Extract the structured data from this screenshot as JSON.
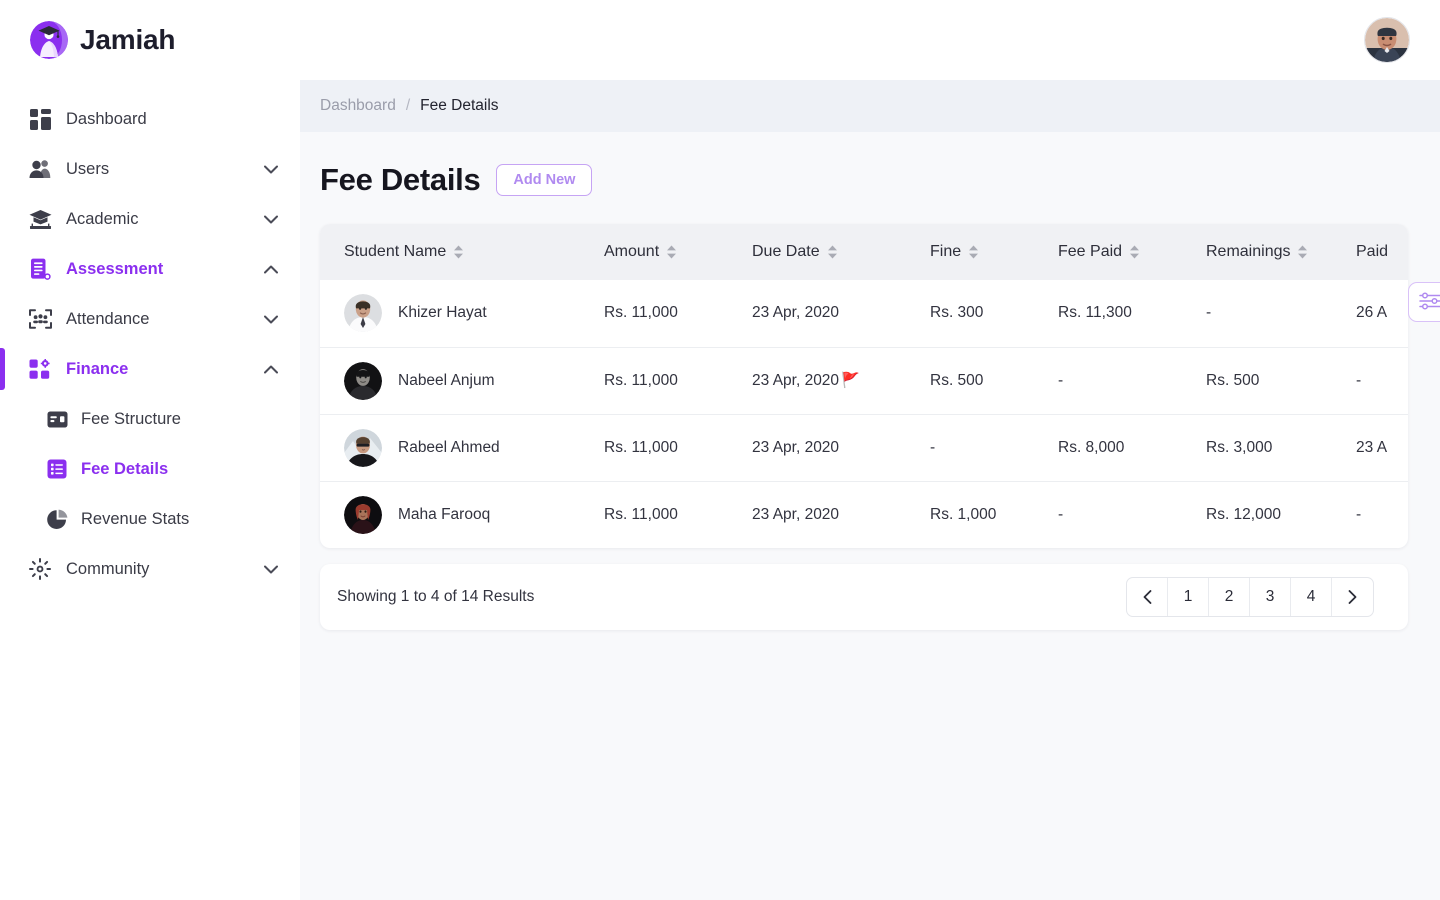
{
  "brand": {
    "name": "Jamiah",
    "logo_icon": "graduate-circle-logo",
    "logo_color": "#8b2fef"
  },
  "theme": {
    "accent": "#8b2fef",
    "accent_soft": "#b08af0",
    "page_bg": "#f8f9fb",
    "breadcrumb_bg": "#eef1f6",
    "table_header_bg": "#f0f1f4",
    "text_primary": "#23242f",
    "text_muted": "#9a9daa",
    "flag_color": "#b84a3a"
  },
  "topbar": {
    "avatar_icon": "user-avatar",
    "avatar_alt": "Account avatar"
  },
  "sidebar": {
    "items": [
      {
        "label": "Dashboard",
        "icon": "dashboard-grid-icon",
        "expandable": false,
        "active": false
      },
      {
        "label": "Users",
        "icon": "users-icon",
        "expandable": true,
        "expanded": false,
        "active": false
      },
      {
        "label": "Academic",
        "icon": "graduation-cap-icon",
        "expandable": true,
        "expanded": false,
        "active": false
      },
      {
        "label": "Assessment",
        "icon": "assessment-document-icon",
        "expandable": true,
        "expanded": true,
        "active": true
      },
      {
        "label": "Attendance",
        "icon": "attendance-people-icon",
        "expandable": true,
        "expanded": false,
        "active": false
      },
      {
        "label": "Finance",
        "icon": "finance-grid-gear-icon",
        "expandable": true,
        "expanded": true,
        "active": true
      },
      {
        "label": "Community",
        "icon": "community-network-icon",
        "expandable": true,
        "expanded": false,
        "active": false
      }
    ],
    "finance_children": [
      {
        "label": "Fee Structure",
        "icon": "fee-structure-card-icon",
        "active": false
      },
      {
        "label": "Fee Details",
        "icon": "fee-details-list-icon",
        "active": true
      },
      {
        "label": "Revenue Stats",
        "icon": "revenue-pie-icon",
        "active": false
      }
    ]
  },
  "breadcrumb": {
    "parent": "Dashboard",
    "separator": "/",
    "current": "Fee Details"
  },
  "page": {
    "title": "Fee Details",
    "add_new_label": "Add New",
    "filter_icon": "filter-sliders-icon"
  },
  "table": {
    "columns": [
      {
        "label": "Student Name",
        "sortable": true
      },
      {
        "label": "Amount",
        "sortable": true
      },
      {
        "label": "Due Date",
        "sortable": true
      },
      {
        "label": "Fine",
        "sortable": true
      },
      {
        "label": "Fee Paid",
        "sortable": true
      },
      {
        "label": "Remainings",
        "sortable": true
      },
      {
        "label": "Paid",
        "sortable": true
      }
    ],
    "rows": [
      {
        "student_name": "Khizer Hayat",
        "avatar_icon": "student-avatar",
        "amount": "Rs. 11,000",
        "due_date": "23 Apr, 2020",
        "due_flagged": false,
        "fine": "Rs. 300",
        "fee_paid": "Rs. 11,300",
        "remainings": "-",
        "paid_date": "26 A"
      },
      {
        "student_name": "Nabeel Anjum",
        "avatar_icon": "student-avatar",
        "amount": "Rs. 11,000",
        "due_date": "23 Apr, 2020",
        "due_flagged": true,
        "flag_glyph": "🚩",
        "fine": "Rs. 500",
        "fee_paid": "-",
        "remainings": "Rs. 500",
        "paid_date": "-"
      },
      {
        "student_name": "Rabeel Ahmed",
        "avatar_icon": "student-avatar",
        "amount": "Rs. 11,000",
        "due_date": "23 Apr, 2020",
        "due_flagged": false,
        "fine": "-",
        "fee_paid": "Rs. 8,000",
        "remainings": "Rs. 3,000",
        "paid_date": "23 A"
      },
      {
        "student_name": "Maha Farooq",
        "avatar_icon": "student-avatar",
        "amount": "Rs. 11,000",
        "due_date": "23 Apr, 2020",
        "due_flagged": false,
        "fine": "Rs. 1,000",
        "fee_paid": "-",
        "remainings": "Rs. 12,000",
        "paid_date": "-"
      }
    ]
  },
  "pagination": {
    "showing_text": "Showing 1 to 4 of 14 Results",
    "prev_icon": "chevron-left-icon",
    "next_icon": "chevron-right-icon",
    "pages": [
      "1",
      "2",
      "3",
      "4"
    ],
    "current_page": "1"
  }
}
